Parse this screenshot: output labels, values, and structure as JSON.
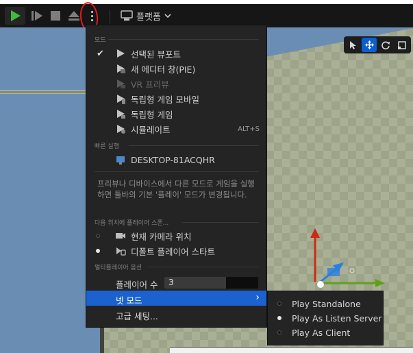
{
  "toolbar": {
    "platform_label": "플랫폼"
  },
  "menu": {
    "section_modes": "모드",
    "modes": [
      {
        "label": "선택된 뷰포트",
        "checked": true,
        "enabled": true,
        "shortcut": ""
      },
      {
        "label": "새 에디터 창(PIE)",
        "checked": false,
        "enabled": true,
        "shortcut": ""
      },
      {
        "label": "VR 프리뷰",
        "checked": false,
        "enabled": false,
        "shortcut": ""
      },
      {
        "label": "독립형 게임 모바일",
        "checked": false,
        "enabled": true,
        "shortcut": ""
      },
      {
        "label": "독립형 게임",
        "checked": false,
        "enabled": true,
        "shortcut": ""
      },
      {
        "label": "시뮬레이트",
        "checked": false,
        "enabled": true,
        "shortcut": "ALT+S"
      }
    ],
    "section_quick_launch": "빠른 실행",
    "device_label": "DESKTOP-81ACQHR",
    "help_text": "프리뷰나 디바이스에서 다른 모드로 게임을 실행하면 툴바의 기본 '플레이' 모드가 변경됩니다.",
    "section_spawn": "다음 위치에 플레이어 스폰...",
    "spawn_options": [
      {
        "label": "현재 카메라 위치",
        "selected": false
      },
      {
        "label": "디폴트 플레이어 스타트",
        "selected": true
      }
    ],
    "section_multiplayer": "멀티플레이어 옵션",
    "player_count_label": "플레이어 수",
    "player_count_value": "3",
    "player_count_fill_fraction": 0.66,
    "net_mode_label": "넷 모드",
    "advanced_label": "고급 세팅..."
  },
  "submenu": {
    "items": [
      {
        "label": "Play Standalone",
        "selected": false
      },
      {
        "label": "Play As Listen Server",
        "selected": true
      },
      {
        "label": "Play As Client",
        "selected": false
      }
    ]
  },
  "colors": {
    "play_green": "#3fbc3c",
    "highlight_blue": "#1b62d0",
    "annotation_red": "#e21b1b"
  }
}
